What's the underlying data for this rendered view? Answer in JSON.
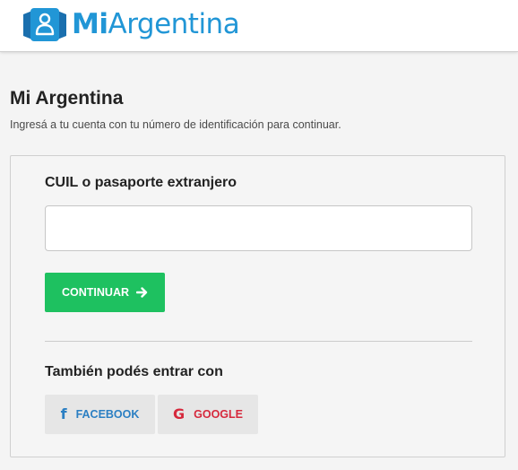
{
  "header": {
    "brand_prefix": "Mi",
    "brand_suffix": "Argentina",
    "brand_color": "#2196d6",
    "logo_icon": "person-badge-icon"
  },
  "main": {
    "title": "Mi Argentina",
    "subtitle": "Ingresá a tu cuenta con tu número de identificación para continuar."
  },
  "login": {
    "field_label": "CUIL o pasaporte extranjero",
    "input_value": "",
    "input_placeholder": "",
    "continue_label": "CONTINUAR",
    "continue_color": "#1ec160",
    "continue_icon": "arrow-right-icon",
    "social_label": "También podés entrar con",
    "facebook_label": "FACEBOOK",
    "facebook_icon": "facebook-icon",
    "facebook_color": "#2b7fc3",
    "google_label": "GOOGLE",
    "google_icon": "google-icon",
    "google_color": "#d6283c"
  }
}
